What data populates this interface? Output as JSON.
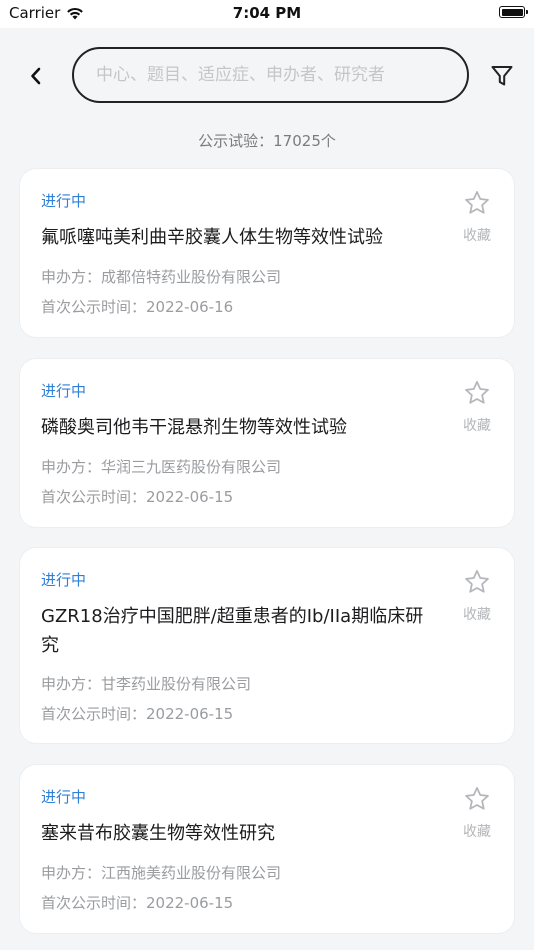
{
  "status_bar": {
    "carrier": "Carrier",
    "time": "7:04 PM"
  },
  "search": {
    "placeholder": "中心、题目、适应症、申办者、研究者"
  },
  "summary": {
    "count_text": "公示试验：17025个"
  },
  "colors": {
    "status_blue": "#2f7fd9",
    "background": "#f4f5f7",
    "card": "#ffffff",
    "muted_text": "#9a9ca0"
  },
  "trials": [
    {
      "status": "进行中",
      "title": "氟哌噻吨美利曲辛胶囊人体生物等效性试验",
      "sponsor": "申办方：成都倍特药业股份有限公司",
      "date": "首次公示时间：2022-06-16",
      "fav_label": "收藏"
    },
    {
      "status": "进行中",
      "title": "磷酸奥司他韦干混悬剂生物等效性试验",
      "sponsor": "申办方：华润三九医药股份有限公司",
      "date": "首次公示时间：2022-06-15",
      "fav_label": "收藏"
    },
    {
      "status": "进行中",
      "title": "GZR18治疗中国肥胖/超重患者的Ib/IIa期临床研究",
      "sponsor": "申办方：甘李药业股份有限公司",
      "date": "首次公示时间：2022-06-15",
      "fav_label": "收藏"
    },
    {
      "status": "进行中",
      "title": "塞来昔布胶囊生物等效性研究",
      "sponsor": "申办方：江西施美药业股份有限公司",
      "date": "首次公示时间：2022-06-15",
      "fav_label": "收藏"
    }
  ]
}
